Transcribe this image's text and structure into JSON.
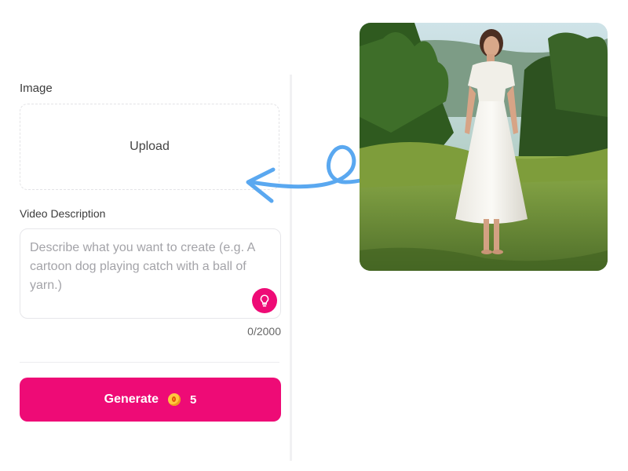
{
  "form": {
    "image_label": "Image",
    "upload_label": "Upload",
    "description_label": "Video Description",
    "description_placeholder": "Describe what you want to create (e.g. A cartoon dog playing catch with a ball of yarn.)",
    "char_counter": "0/2000",
    "generate_label": "Generate",
    "generate_cost": "5"
  },
  "icons": {
    "inspiration": "lightbulb-icon",
    "credits": "coin-icon",
    "pointer": "curly-arrow-icon"
  },
  "colors": {
    "accent": "#ee0b76",
    "arrow": "#5aa8f0",
    "coin": "#ffc83d"
  },
  "preview": {
    "image_subject": "woman in white dress standing in a green meadow"
  }
}
